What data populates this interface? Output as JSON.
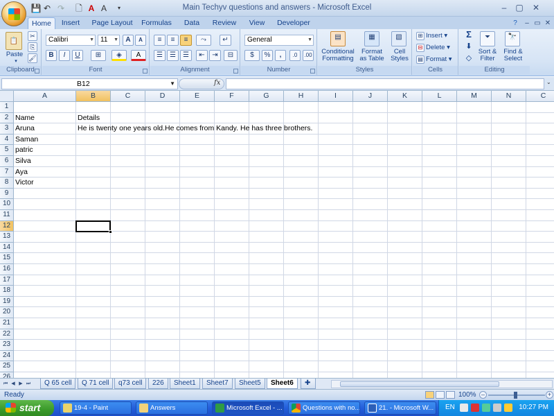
{
  "window": {
    "title": "Main Techyv questions and answers - Microsoft Excel",
    "controls": [
      "–",
      "▢",
      "✕"
    ]
  },
  "ribbon_tabs": [
    "Home",
    "Insert",
    "Page Layout",
    "Formulas",
    "Data",
    "Review",
    "View",
    "Developer"
  ],
  "active_tab": "Home",
  "ribbon": {
    "clipboard": {
      "label": "Clipboard",
      "paste": "Paste"
    },
    "font": {
      "label": "Font",
      "font_name": "Calibri",
      "font_size": "11",
      "bold": "B",
      "italic": "I",
      "underline": "U"
    },
    "alignment": {
      "label": "Alignment"
    },
    "number": {
      "label": "Number",
      "format": "General",
      "currency": "$",
      "percent": "%",
      "comma": ","
    },
    "styles": {
      "label": "Styles",
      "conditional": [
        "Conditional",
        "Formatting"
      ],
      "format_table": [
        "Format",
        "as Table"
      ],
      "cell_styles": [
        "Cell",
        "Styles"
      ]
    },
    "cells": {
      "label": "Cells",
      "insert": "Insert",
      "delete": "Delete",
      "format": "Format"
    },
    "editing": {
      "label": "Editing",
      "sort": [
        "Sort &",
        "Filter"
      ],
      "find": [
        "Find &",
        "Select"
      ]
    }
  },
  "formula_bar": {
    "name_box": "B12",
    "fx": "fx",
    "formula": ""
  },
  "columns": [
    "A",
    "B",
    "C",
    "D",
    "E",
    "F",
    "G",
    "H",
    "I",
    "J",
    "K",
    "L",
    "M",
    "N",
    "C"
  ],
  "selected_column": "B",
  "rows": [
    "1",
    "2",
    "3",
    "4",
    "5",
    "6",
    "7",
    "8",
    "9",
    "10",
    "11",
    "12",
    "13",
    "14",
    "15",
    "16",
    "17",
    "18",
    "19",
    "20",
    "21",
    "22",
    "23",
    "24",
    "25",
    "26"
  ],
  "selected_row": "12",
  "cells": {
    "A2": "Name",
    "B2": "Details",
    "A3": "Aruna",
    "B3": "He is twenty one years old.He comes from Kandy. He has three brothers.",
    "A4": "Saman",
    "A5": "patric",
    "A6": "Silva",
    "A7": "Aya",
    "A8": "Victor"
  },
  "sheet_tabs": [
    "Q 65 cell",
    "Q 71 cell",
    "q73 cell",
    "226",
    "Sheet1",
    "Sheet7",
    "Sheet5",
    "Sheet6"
  ],
  "active_sheet": "Sheet6",
  "status": {
    "mode": "Ready",
    "zoom": "100%"
  },
  "taskbar": {
    "start": "start",
    "tasks": [
      "19-4 - Paint",
      "Answers",
      "Microsoft Excel - ...",
      "Questions with no...",
      "21. - Microsoft W..."
    ],
    "active_task": "Microsoft Excel - ...",
    "lang": "EN",
    "clock": "10:27 PM"
  }
}
